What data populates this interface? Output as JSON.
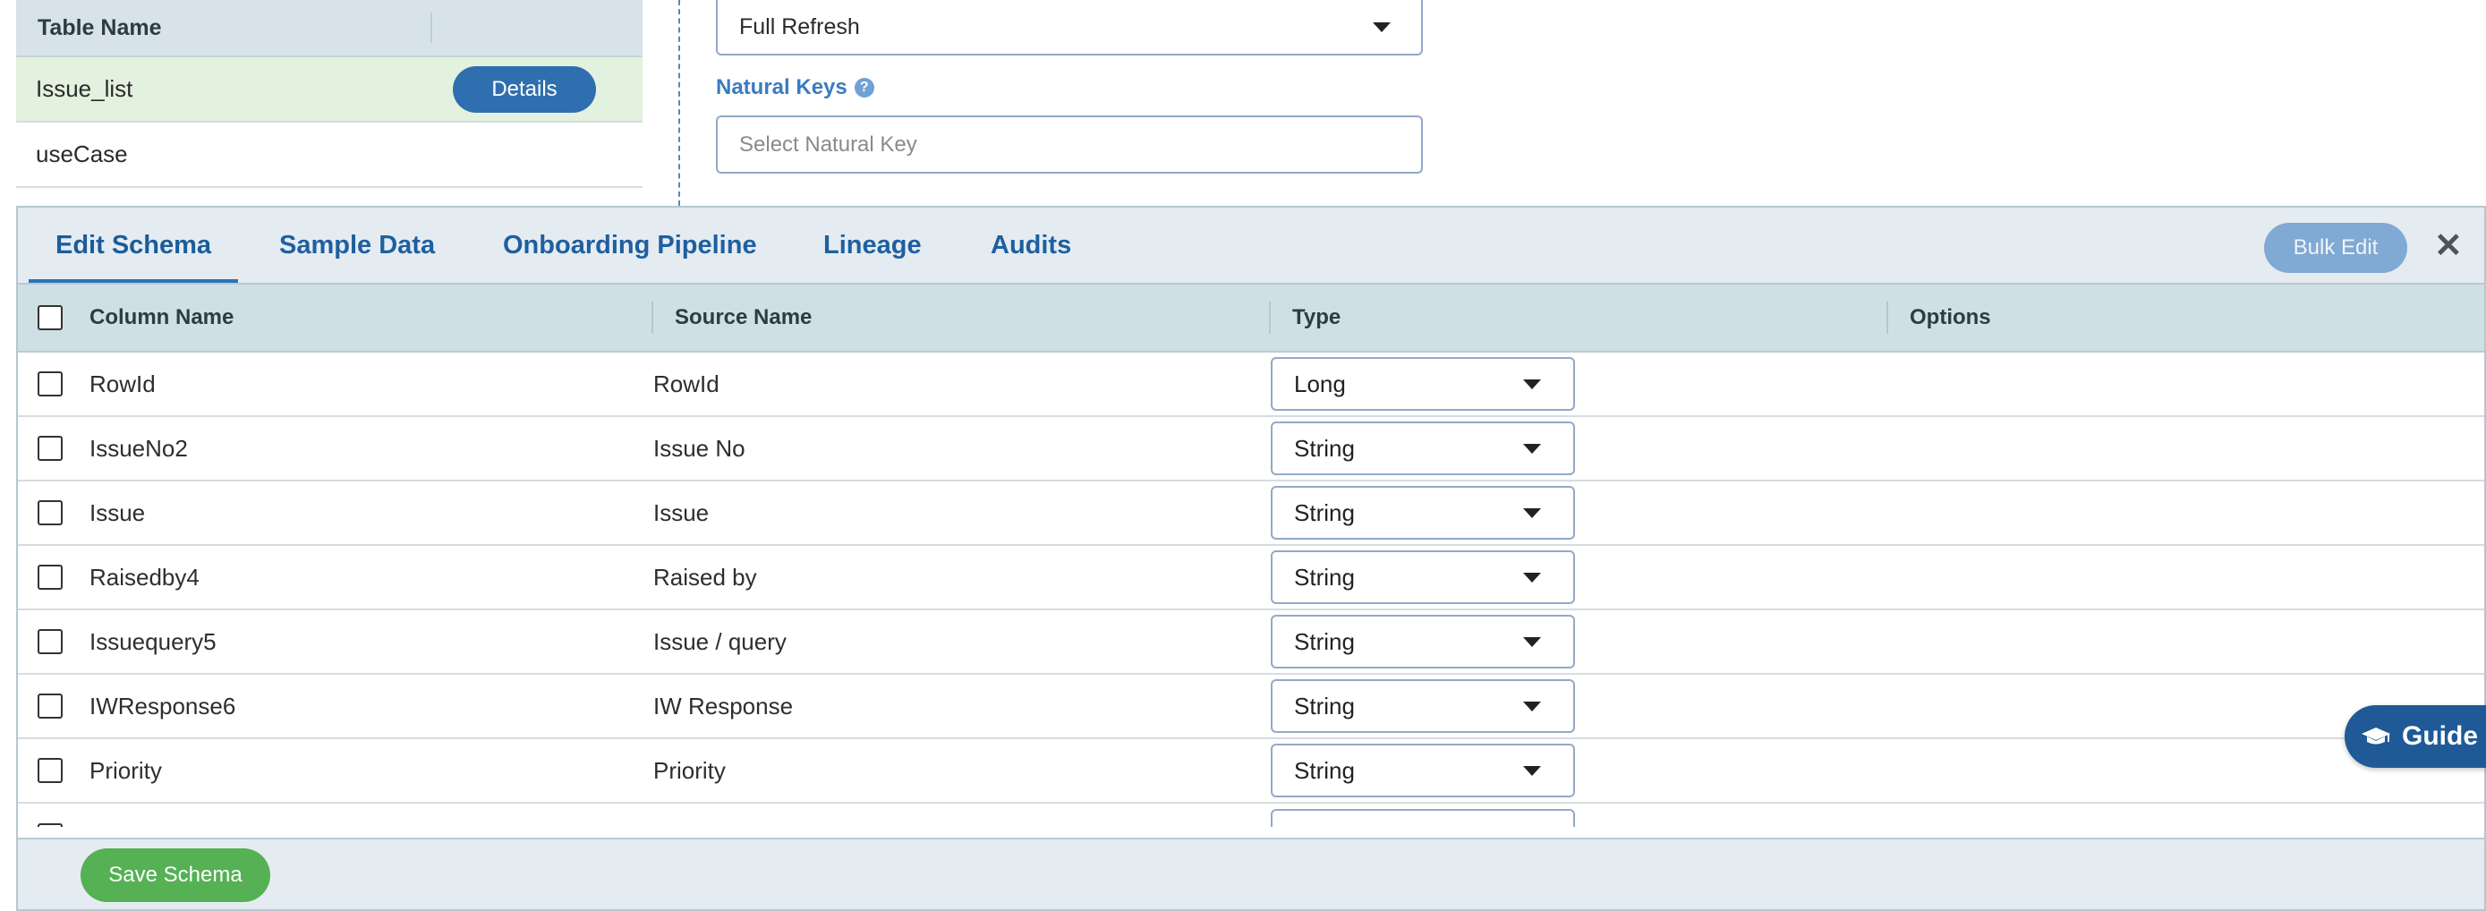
{
  "tables": {
    "header": "Table Name",
    "rows": [
      {
        "name": "Issue_list",
        "button": "Details"
      },
      {
        "name": "useCase"
      }
    ]
  },
  "form": {
    "sync_type": "Full Refresh",
    "natural_keys_label": "Natural Keys",
    "natural_keys_placeholder": "Select Natural Key"
  },
  "schema": {
    "tabs": [
      "Edit Schema",
      "Sample Data",
      "Onboarding Pipeline",
      "Lineage",
      "Audits"
    ],
    "active_tab": "Edit Schema",
    "bulk_edit_label": "Bulk Edit",
    "columns": [
      "Column Name",
      "Source Name",
      "Type",
      "Options"
    ],
    "rows": [
      {
        "name": "RowId",
        "source": "RowId",
        "type": "Long"
      },
      {
        "name": "IssueNo2",
        "source": "Issue No",
        "type": "String"
      },
      {
        "name": "Issue",
        "source": "Issue",
        "type": "String"
      },
      {
        "name": "Raisedby4",
        "source": "Raised by",
        "type": "String"
      },
      {
        "name": "Issuequery5",
        "source": "Issue / query",
        "type": "String"
      },
      {
        "name": "IWResponse6",
        "source": "IW Response",
        "type": "String"
      },
      {
        "name": "Priority",
        "source": "Priority",
        "type": "String"
      }
    ],
    "save_label": "Save Schema"
  },
  "guide_label": "Guide",
  "icons": {
    "help": "help-icon",
    "close": "close-icon",
    "caret": "chevron-down-icon",
    "guide": "graduation-cap-icon"
  }
}
